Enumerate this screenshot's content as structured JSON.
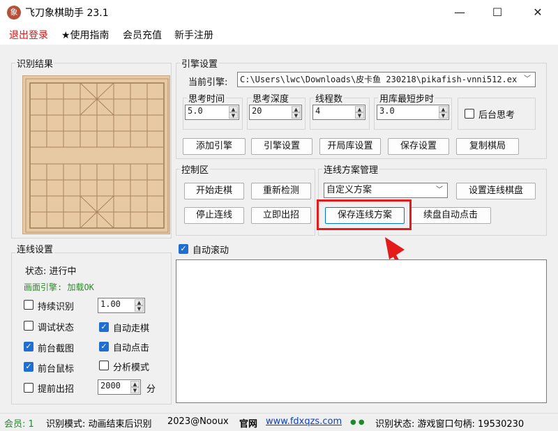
{
  "window": {
    "icon_char": "象",
    "title": "飞刀象棋助手 23.1",
    "min_glyph": "—",
    "max_glyph": "☐",
    "close_glyph": "✕"
  },
  "menu": {
    "logout": "退出登录",
    "guide": "★使用指南",
    "recharge": "会员充值",
    "register": "新手注册"
  },
  "recognition": {
    "title": "识别结果"
  },
  "engine_settings": {
    "title": "引擎设置",
    "current_engine_label": "当前引擎:",
    "current_engine_value": "C:\\Users\\lwc\\Downloads\\皮卡鱼 230218\\pikafish-vnni512.ex",
    "think_time_label": "思考时间",
    "think_time_value": "5.0",
    "think_depth_label": "思考深度",
    "think_depth_value": "20",
    "threads_label": "线程数",
    "threads_value": "4",
    "book_min_steps_label": "用库最短步时",
    "book_min_steps_value": "3.0",
    "background_think_label": "后台思考",
    "buttons": {
      "add_engine": "添加引擎",
      "engine_config": "引擎设置",
      "opening_book": "开局库设置",
      "save_settings": "保存设置",
      "copy_board": "复制棋局"
    }
  },
  "control": {
    "title": "控制区",
    "start_move": "开始走棋",
    "redetect": "重新检测",
    "stop_link": "停止连线",
    "move_now": "立即出招"
  },
  "scheme": {
    "title": "连线方案管理",
    "selected": "自定义方案",
    "set_board": "设置连线棋盘",
    "save_scheme": "保存连线方案",
    "auto_click": "续盘自动点击"
  },
  "link_settings": {
    "title": "连线设置",
    "status_label": "状态: 进行中",
    "screen_engine": "画面引擎: 加载OK",
    "continuous_recognition": "持续识别",
    "continuous_value": "1.00",
    "debug_state": "调试状态",
    "auto_move": "自动走棋",
    "foreground_capture": "前台截图",
    "auto_click": "自动点击",
    "foreground_mouse": "前台鼠标",
    "analysis_mode": "分析模式",
    "early_move": "提前出招",
    "early_value": "2000",
    "unit": "分"
  },
  "auto_scroll": "自动滚动",
  "statusbar": {
    "member": "会员: 1",
    "mode": "识别模式: 动画结束后识别",
    "copyright": "2023@Nooux",
    "site_label": "官网",
    "site_url": "www.fdxqzs.com",
    "dots": "● ●",
    "recognition_state": "识别状态: 游戏窗口句柄: 19530230"
  },
  "colors": {
    "accent": "#0078d7",
    "menu_red": "#d11717",
    "ok_green": "#2b8a2b",
    "highlight_red": "#e51b1b",
    "board": "#e7c9a3"
  }
}
